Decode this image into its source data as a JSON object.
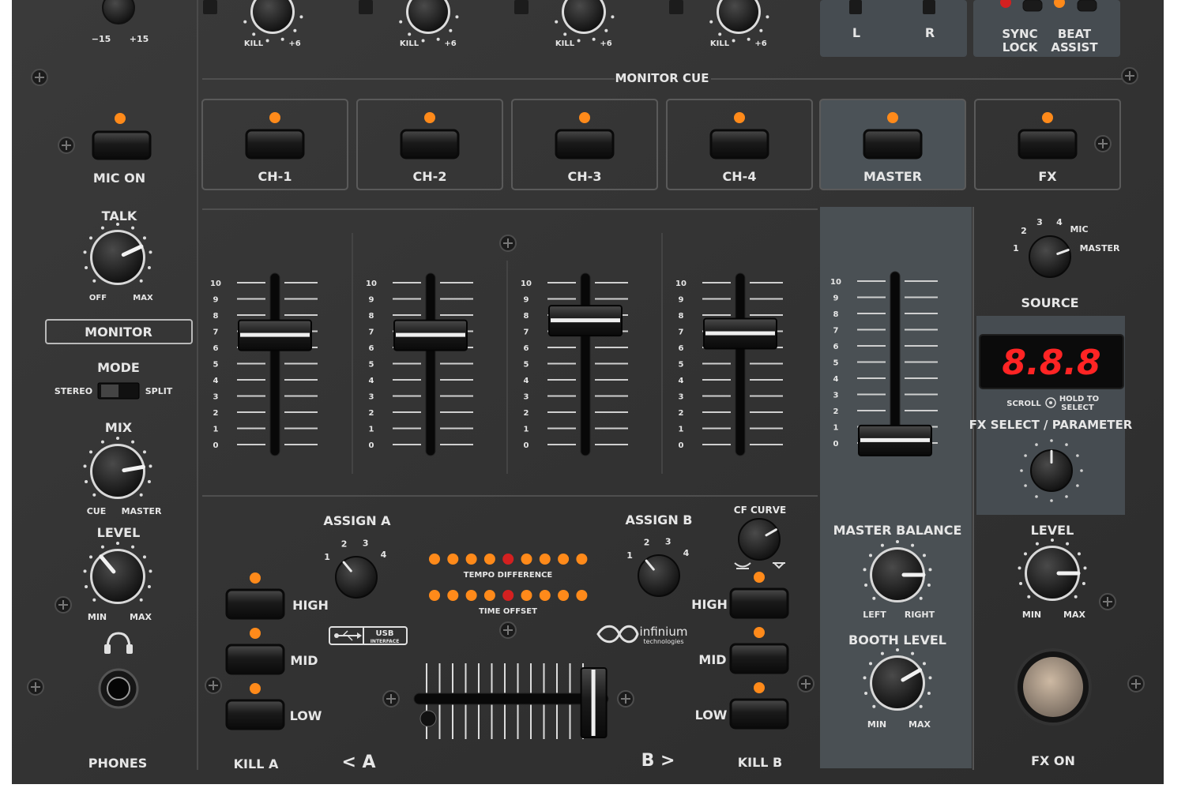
{
  "colors": {
    "panel": "#343434",
    "panel_light": "#3f4245",
    "master_panel": "#4b5257",
    "label": "#e6e6e6",
    "led_amber": "#ff8a1a",
    "led_red": "#d42020",
    "display_red": "#ff2424"
  },
  "mic_section": {
    "gain_min": "−15",
    "gain_max": "+15",
    "mic_on": "MIC ON",
    "talk": "TALK",
    "talk_min": "OFF",
    "talk_max": "MAX",
    "monitor": "MONITOR",
    "mode": "MODE",
    "mode_left": "STEREO",
    "mode_right": "SPLIT",
    "mix": "MIX",
    "mix_min": "CUE",
    "mix_max": "MASTER",
    "level": "LEVEL",
    "level_min": "MIN",
    "level_max": "MAX",
    "phones": "PHONES"
  },
  "top": {
    "kill_label": "KILL",
    "boost_label": "+6",
    "left": "L",
    "right": "R",
    "sync_lock": "SYNC",
    "sync_lock2": "LOCK",
    "beat_assist": "BEAT",
    "beat_assist2": "ASSIST"
  },
  "monitor_cue": {
    "title": "MONITOR CUE",
    "buttons": [
      "CH-1",
      "CH-2",
      "CH-3",
      "CH-4",
      "MASTER",
      "FX"
    ]
  },
  "fader_scale": [
    "10",
    "9",
    "8",
    "7",
    "6",
    "5",
    "4",
    "3",
    "2",
    "1",
    "0"
  ],
  "channel_faders": [
    6.8,
    6.8,
    7.7,
    6.9
  ],
  "master_fader": 0.2,
  "source": {
    "title": "SOURCE",
    "marks": [
      "1",
      "2",
      "3",
      "4",
      "MIC",
      "MASTER"
    ]
  },
  "fx": {
    "display": "8.8.8",
    "scroll": "SCROLL",
    "hold": "HOLD TO",
    "select": "SELECT",
    "title": "FX SELECT / PARAMETER",
    "level": "LEVEL",
    "level_min": "MIN",
    "level_max": "MAX",
    "fx_on": "FX ON"
  },
  "master": {
    "balance": "MASTER BALANCE",
    "bal_left": "LEFT",
    "bal_right": "RIGHT",
    "booth": "BOOTH LEVEL",
    "booth_min": "MIN",
    "booth_max": "MAX"
  },
  "crossfader": {
    "assign_a": "ASSIGN A",
    "assign_b": "ASSIGN B",
    "assign_marks": [
      "1",
      "2",
      "3",
      "4"
    ],
    "cf_curve": "CF CURVE",
    "tempo_difference": "TEMPO DIFFERENCE",
    "time_offset": "TIME OFFSET",
    "a_arrow": "< A",
    "b_arrow": "B >",
    "kill_a": "KILL A",
    "kill_b": "KILL B",
    "high": "HIGH",
    "mid": "MID",
    "low": "LOW",
    "usb": "USB",
    "usb_sub": "INTERFACE",
    "brand": "infinium",
    "brand_sub": "technologies",
    "position": 0.92
  }
}
